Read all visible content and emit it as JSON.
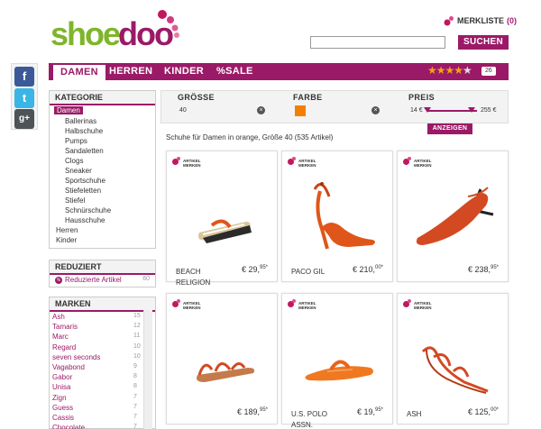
{
  "header": {
    "logo_text": "shoedoo",
    "merkliste_label": "MERKLISTE",
    "merkliste_count": "(0)",
    "search_placeholder": "",
    "search_button": "SUCHEN"
  },
  "nav": {
    "tabs": [
      "DAMEN",
      "HERREN",
      "KINDER",
      "%SALE"
    ],
    "rating_count": "26",
    "rating_stars": 4
  },
  "social": [
    "facebook-icon",
    "twitter-icon",
    "google-plus-icon"
  ],
  "kategorie": {
    "title": "KATEGORIE",
    "items": [
      "Damen",
      "Ballerinas",
      "Halbschuhe",
      "Pumps",
      "Sandaletten",
      "Clogs",
      "Sneaker",
      "Sportschuhe",
      "Stiefeletten",
      "Stiefel",
      "Schnürschuhe",
      "Hausschuhe",
      "Herren",
      "Kinder"
    ]
  },
  "reduziert": {
    "title": "REDUZIERT",
    "label": "Reduzierte Artikel",
    "count": "60"
  },
  "marken": {
    "title": "MARKEN",
    "brands": [
      {
        "name": "Ash",
        "count": "15"
      },
      {
        "name": "Tamaris",
        "count": "12"
      },
      {
        "name": "Marc",
        "count": "11"
      },
      {
        "name": "Regard",
        "count": "10"
      },
      {
        "name": "seven seconds",
        "count": "10"
      },
      {
        "name": "Vagabond",
        "count": "9"
      },
      {
        "name": "Gabor",
        "count": "8"
      },
      {
        "name": "Unisa",
        "count": "8"
      },
      {
        "name": "Zign",
        "count": "7"
      },
      {
        "name": "Guess",
        "count": "7"
      },
      {
        "name": "Cassis",
        "count": "7"
      },
      {
        "name": "Chocolate",
        "count": "7"
      }
    ]
  },
  "filters": {
    "groesse_label": "GRÖSSE",
    "groesse_value": "40",
    "farbe_label": "FARBE",
    "farbe_color": "#f57d00",
    "preis_label": "PREIS",
    "preis_min": "14 €",
    "preis_max": "255 €",
    "anzeigen_button": "ANZEIGEN"
  },
  "result_text": "Schuhe für Damen in orange, Größe 40 (535 Artikel)",
  "merken_label_1": "ARTIKEL",
  "merken_label_2": "MERKEN",
  "products": [
    {
      "name": "BEACH RELIGION",
      "price": "€ 29,",
      "cents": "95*"
    },
    {
      "name": "PACO GIL",
      "price": "€ 210,",
      "cents": "00*"
    },
    {
      "name": "",
      "price": "€ 238,",
      "cents": "95*"
    },
    {
      "name": "",
      "price": "€ 189,",
      "cents": "95*"
    },
    {
      "name": "U.S. POLO ASSN.",
      "price": "€ 19,",
      "cents": "95*"
    },
    {
      "name": "ASH",
      "price": "€ 125,",
      "cents": "00*"
    }
  ],
  "colors": {
    "brand": "#9b1a67",
    "accent_orange": "#f57d00",
    "star": "#f2a412"
  }
}
